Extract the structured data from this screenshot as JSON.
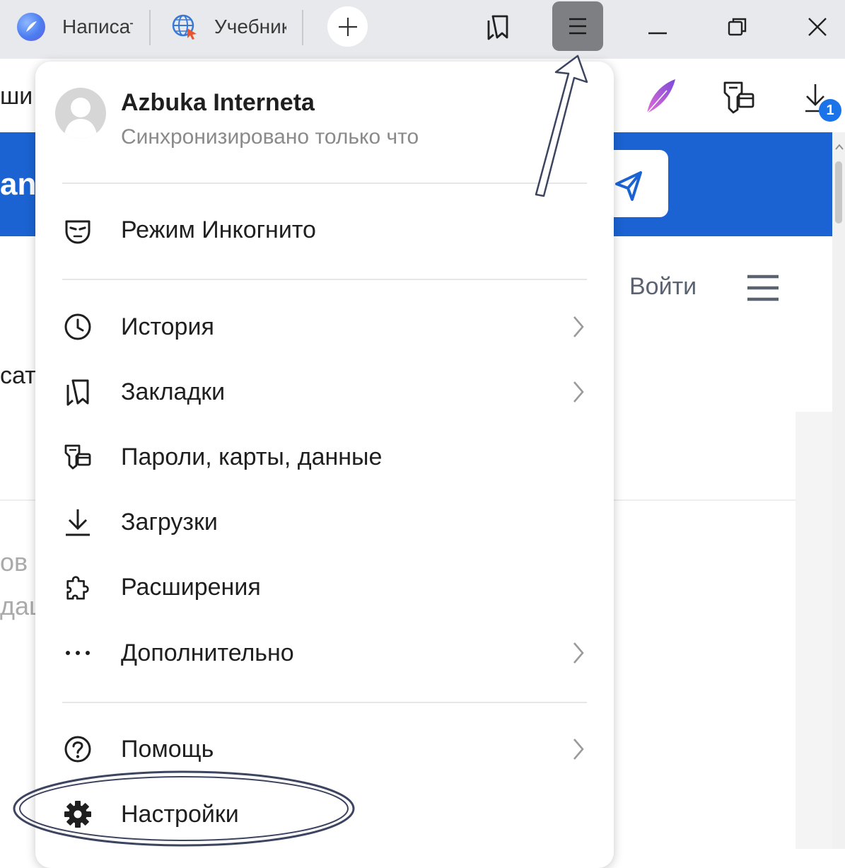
{
  "tabs": [
    {
      "label": "Написать"
    },
    {
      "label": "Учебник"
    }
  ],
  "toolbar": {
    "downloads_badge": "1"
  },
  "page": {
    "banner_text": "an",
    "login": "Войти",
    "left_fragments": [
      "ши",
      "сат",
      "ов",
      "дац"
    ]
  },
  "menu": {
    "account": {
      "name": "Azbuka Interneta",
      "status": "Синхронизировано только что"
    },
    "items": [
      {
        "label": "Режим Инкогнито",
        "icon": "incognito-mask-icon"
      },
      {
        "label": "История",
        "icon": "clock-icon",
        "submenu": true
      },
      {
        "label": "Закладки",
        "icon": "bookmarks-icon",
        "submenu": true
      },
      {
        "label": "Пароли, карты, данные",
        "icon": "key-card-icon"
      },
      {
        "label": "Загрузки",
        "icon": "download-icon"
      },
      {
        "label": "Расширения",
        "icon": "puzzle-icon"
      },
      {
        "label": "Дополнительно",
        "icon": "more-dots-icon",
        "submenu": true
      },
      {
        "label": "Помощь",
        "icon": "help-icon",
        "submenu": true
      },
      {
        "label": "Настройки",
        "icon": "gear-icon"
      }
    ]
  },
  "colors": {
    "accent_blue": "#1b63d2",
    "menu_button_active": "#7d7f82",
    "annotation": "#3d4460"
  }
}
